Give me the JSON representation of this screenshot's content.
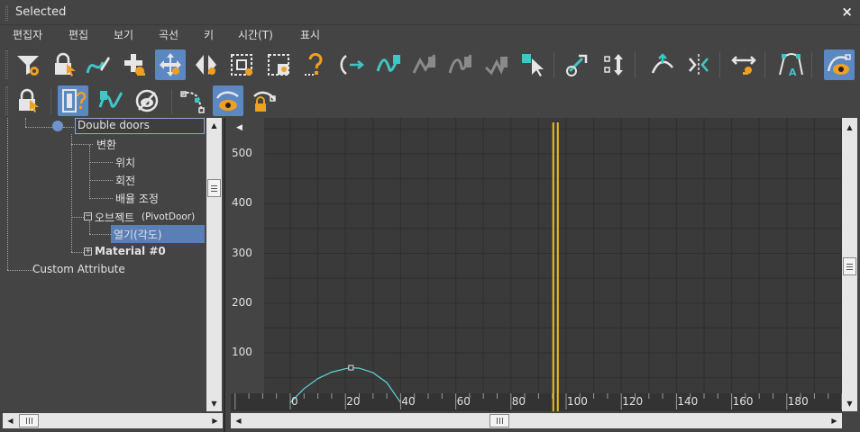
{
  "window": {
    "title": "Selected",
    "close_label": "×"
  },
  "menu": [
    "편집자",
    "편집",
    "보기",
    "곡선",
    "키",
    "시간(T)",
    "표시"
  ],
  "toolbar1": {
    "buttons": [
      "filter-icon",
      "lock-selection-icon",
      "draw-curves-icon",
      "add-keys-icon",
      "move-keys-icon",
      "slide-keys-icon",
      "scale-keys-icon",
      "scale-values-icon",
      "insert-key-icon",
      "parameter-out-of-range-icon",
      "snap-frames-icon",
      "tangent-auto-icon",
      "tangent-spline-icon",
      "tangent-fast-icon",
      "tangent-linear-icon",
      "tangent-step-icon",
      "move-key-horizontal-icon",
      "move-key-vertical-icon",
      "break-tangents-icon",
      "unify-tangents-icon",
      "normalize-icon",
      "show-tangents-icon",
      "key-stats-icon",
      "show-curves-icon"
    ]
  },
  "toolbar2": {
    "buttons": [
      "lock-tangents-icon",
      "isolate-curve-icon",
      "show-keyable-icon",
      "show-all-tangents-icon",
      "show-biped-positions-icon",
      "show-non-selected-curves-icon",
      "lock-curve-icon"
    ]
  },
  "tree": {
    "root": "Double doors",
    "transform": "변환",
    "position": "위치",
    "rotation": "회전",
    "scale": "배율 조정",
    "object": "오브젝트",
    "object_type": "(PivotDoor)",
    "open_angle": "열기(각도)",
    "material": "Material #0",
    "custom_attr": "Custom Attribute"
  },
  "graph": {
    "y_ticks": [
      "500",
      "400",
      "300",
      "200",
      "100"
    ],
    "x_ticks": [
      "0",
      "20",
      "40",
      "60",
      "80",
      "100",
      "120",
      "140",
      "160",
      "180"
    ],
    "collapse_arrow": "◀"
  },
  "colors": {
    "background": "#444444",
    "graph_bg": "#3a3a3a",
    "grid": "#2f2f2f",
    "selection": "#5a7fb7",
    "active_button": "#5b87c3",
    "time_slider": "#e8c21a",
    "curve": "#5fd4d4",
    "icon_teal": "#3fc6c6",
    "icon_orange": "#f0a020"
  },
  "chart_data": {
    "type": "line",
    "x_range": [
      -20,
      195
    ],
    "y_range": [
      0,
      540
    ],
    "time_slider_frame": 96,
    "series": [
      {
        "values_x": [
          0,
          5,
          10,
          15,
          20,
          22,
          25,
          30,
          35,
          40
        ],
        "values_y": [
          0,
          28,
          48,
          61,
          68,
          70,
          69,
          60,
          40,
          0
        ]
      }
    ],
    "keys": [
      {
        "x": 22,
        "y": 70
      }
    ]
  }
}
